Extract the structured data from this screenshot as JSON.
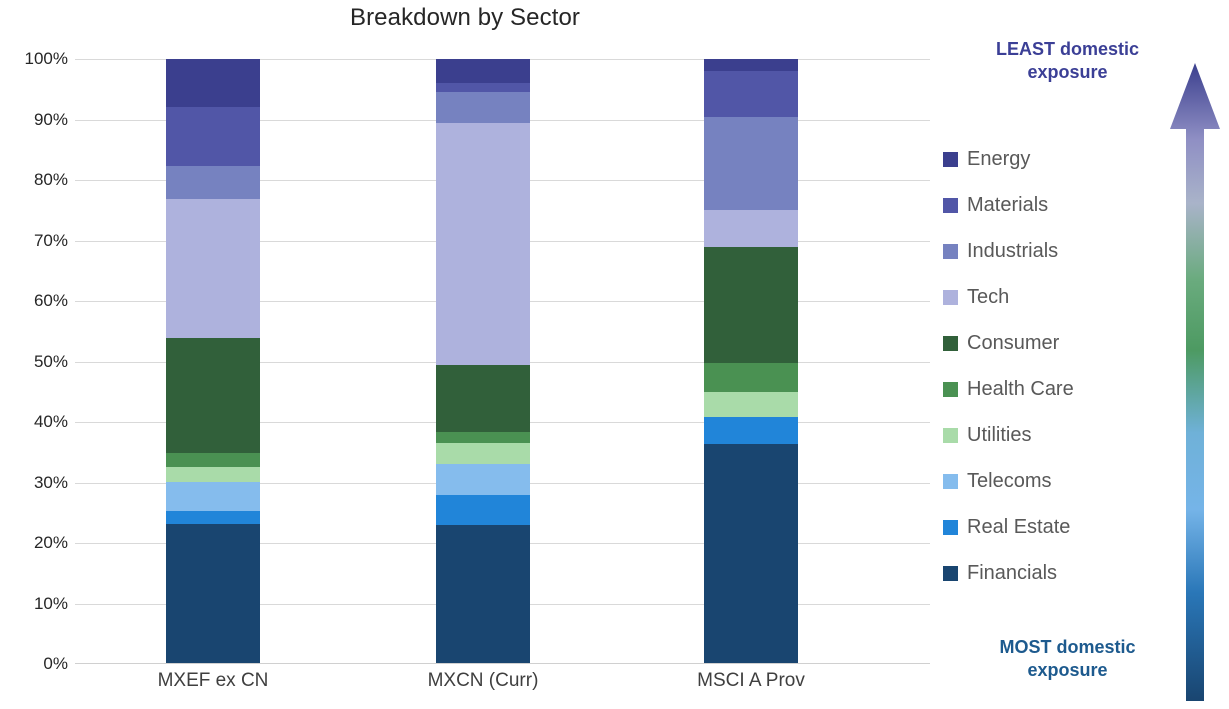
{
  "chart_data": {
    "type": "bar",
    "title": "Breakdown by Sector",
    "xlabel": "",
    "ylabel": "",
    "ylim": [
      0,
      100
    ],
    "stacked": true,
    "grid": true,
    "legend_position": "right",
    "categories": [
      "MXEF ex CN",
      "MXCN (Curr)",
      "MSCI A Prov"
    ],
    "ytick_labels": [
      "100%",
      "90%",
      "80%",
      "70%",
      "60%",
      "50%",
      "40%",
      "30%",
      "20%",
      "10%",
      "0%"
    ],
    "ytick_values": [
      100,
      90,
      80,
      70,
      60,
      50,
      40,
      30,
      20,
      10,
      0
    ],
    "series": [
      {
        "name": "Financials",
        "color": "#194570",
        "values": [
          23.2,
          23.0,
          36.3
        ]
      },
      {
        "name": "Real Estate",
        "color": "#2185d9",
        "values": [
          2.1,
          5.0,
          4.5
        ]
      },
      {
        "name": "Telecoms",
        "color": "#85bced",
        "values": [
          4.8,
          5.1,
          0.0
        ]
      },
      {
        "name": "Utilities",
        "color": "#a9dba9",
        "values": [
          2.4,
          3.5,
          4.1
        ]
      },
      {
        "name": "Health Care",
        "color": "#4a9152",
        "values": [
          2.3,
          1.8,
          4.9
        ]
      },
      {
        "name": "Consumer",
        "color": "#31603a",
        "values": [
          19.1,
          11.1,
          19.2
        ]
      },
      {
        "name": "Tech",
        "color": "#aeb2dd",
        "values": [
          22.9,
          40.0,
          6.0
        ]
      },
      {
        "name": "Industrials",
        "color": "#7682c0",
        "values": [
          5.6,
          5.0,
          15.5
        ]
      },
      {
        "name": "Materials",
        "color": "#5156a7",
        "values": [
          9.7,
          1.5,
          7.5
        ]
      },
      {
        "name": "Energy",
        "color": "#3b3f8e",
        "values": [
          7.9,
          4.0,
          2.0
        ]
      }
    ]
  },
  "legend": {
    "items": [
      {
        "label": "Energy",
        "color": "#3b3f8e"
      },
      {
        "label": "Materials",
        "color": "#5156a7"
      },
      {
        "label": "Industrials",
        "color": "#7682c0"
      },
      {
        "label": "Tech",
        "color": "#aeb2dd"
      },
      {
        "label": "Consumer",
        "color": "#31603a"
      },
      {
        "label": "Health Care",
        "color": "#4a9152"
      },
      {
        "label": "Utilities",
        "color": "#a9dba9"
      },
      {
        "label": "Telecoms",
        "color": "#85bced"
      },
      {
        "label": "Real Estate",
        "color": "#2185d9"
      },
      {
        "label": "Financials",
        "color": "#194570"
      }
    ]
  },
  "annotations": {
    "top": {
      "text": "LEAST domestic exposure",
      "color": "#3b3f96"
    },
    "bottom": {
      "text": "MOST domestic exposure",
      "color": "#1d5a8e"
    },
    "arrow": {
      "name": "up-arrow-icon",
      "direction": "up",
      "gradient_stops": [
        "#194570",
        "#2185d9",
        "#85bced",
        "#4a9152",
        "#aeb2dd",
        "#3b3f8e"
      ]
    }
  }
}
